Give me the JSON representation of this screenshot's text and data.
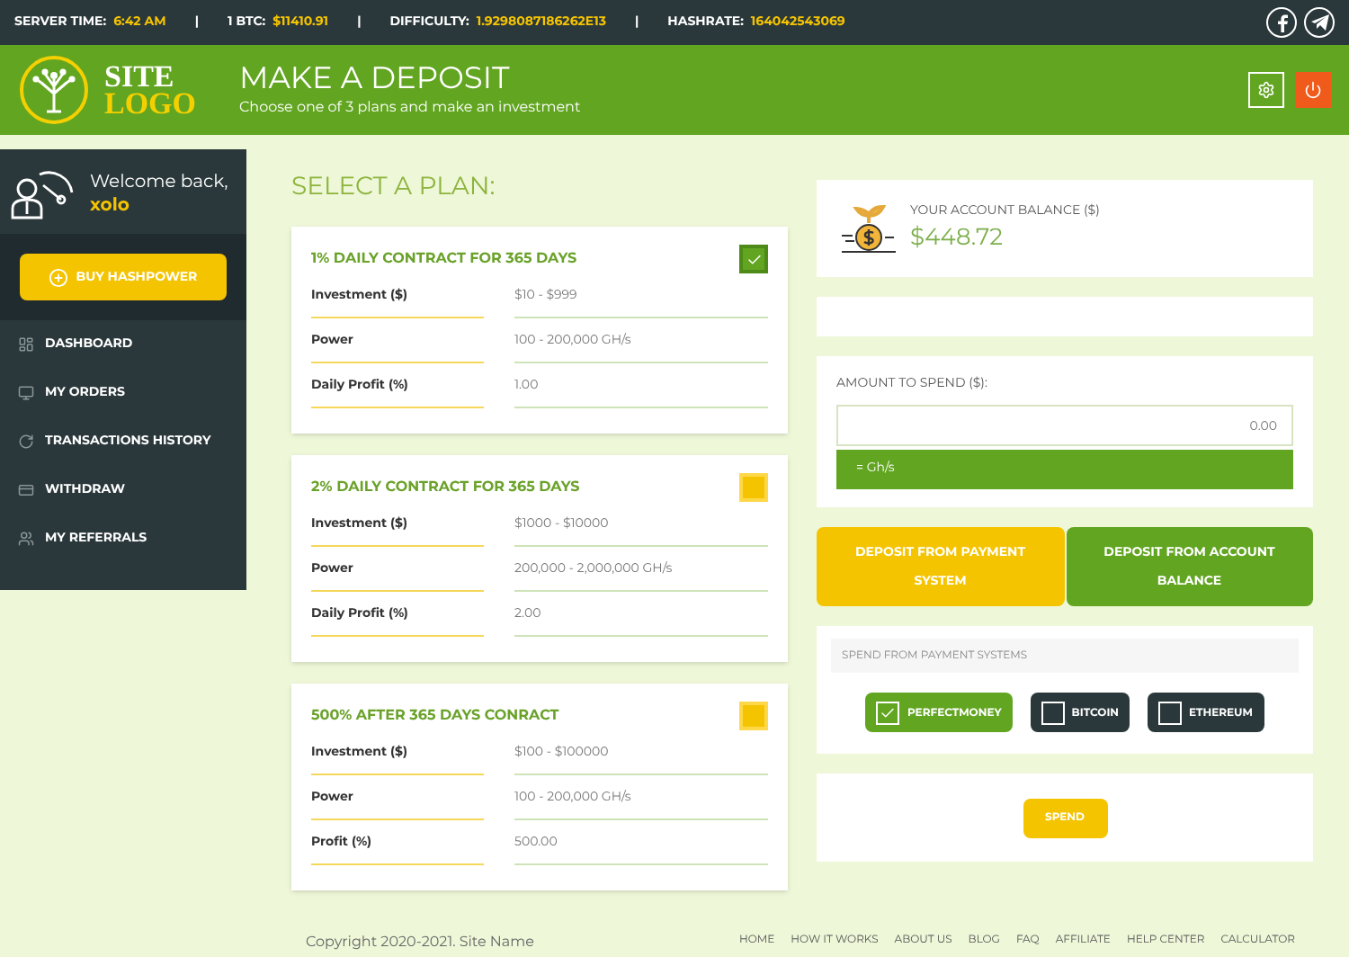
{
  "top_bar": {
    "stats": [
      {
        "label": "SERVER TIME:",
        "value": "6:42 AM"
      },
      {
        "label": "1 BTC:",
        "value": "$11410.91"
      },
      {
        "label": "DIFFICULTY:",
        "value": "1.9298087186262E13"
      },
      {
        "label": "HASHRATE:",
        "value": "164042543069"
      }
    ],
    "separator": "|"
  },
  "header": {
    "logo": {
      "line1": "SITE",
      "line2": "LOGO"
    },
    "title": "MAKE A DEPOSIT",
    "subtitle": "Choose one of 3 plans and make an investment"
  },
  "sidebar": {
    "greeting": "Welcome back,",
    "username": "xolo",
    "buy_button": "BUY HASHPOWER",
    "items": [
      {
        "label": "DASHBOARD"
      },
      {
        "label": "MY ORDERS"
      },
      {
        "label": "TRANSACTIONS HISTORY"
      },
      {
        "label": "WITHDRAW"
      },
      {
        "label": "MY REFERRALS"
      }
    ]
  },
  "plans_heading": "SELECT A PLAN:",
  "plans": [
    {
      "title": "1% DAILY CONTRACT FOR 365 DAYS",
      "selected": true,
      "rows": [
        {
          "label": "Investment ($)",
          "value": "$10 - $999"
        },
        {
          "label": "Power",
          "value": "100 - 200,000 GH/s"
        },
        {
          "label": "Daily Profit (%)",
          "value": "1.00"
        }
      ]
    },
    {
      "title": "2% DAILY CONTRACT FOR 365 DAYS",
      "selected": false,
      "rows": [
        {
          "label": "Investment ($)",
          "value": "$1000 - $10000"
        },
        {
          "label": "Power",
          "value": "200,000 - 2,000,000 GH/s"
        },
        {
          "label": "Daily Profit (%)",
          "value": "2.00"
        }
      ]
    },
    {
      "title": "500% AFTER 365 DAYS CONRACT",
      "selected": false,
      "rows": [
        {
          "label": "Investment ($)",
          "value": "$100 - $100000"
        },
        {
          "label": "Power",
          "value": "100 - 200,000 GH/s"
        },
        {
          "label": "Profit (%)",
          "value": "500.00"
        }
      ]
    }
  ],
  "balance": {
    "label": "YOUR ACCOUNT BALANCE ($)",
    "value": "$448.72"
  },
  "amount": {
    "label": "AMOUNT TO SPEND ($):",
    "placeholder": "0.00",
    "conversion": "= Gh/s"
  },
  "deposit_tabs": [
    {
      "label": "DEPOSIT FROM PAYMENT SYSTEM",
      "selected": true
    },
    {
      "label": "DEPOSIT FROM ACCOUNT BALANCE",
      "selected": false
    }
  ],
  "payment_systems": {
    "heading": "SPEND FROM PAYMENT SYSTEMS",
    "options": [
      {
        "label": "PERFECTMONEY",
        "selected": true
      },
      {
        "label": "BITCOIN",
        "selected": false
      },
      {
        "label": "ETHEREUM",
        "selected": false
      }
    ]
  },
  "spend_button": "SPEND",
  "footer": {
    "copyright": "Copyright 2020-2021. Site Name",
    "links": [
      "HOME",
      "HOW IT WORKS",
      "ABOUT US",
      "BLOG",
      "FAQ",
      "AFFILIATE",
      "HELP CENTER",
      "CALCULATOR"
    ]
  }
}
